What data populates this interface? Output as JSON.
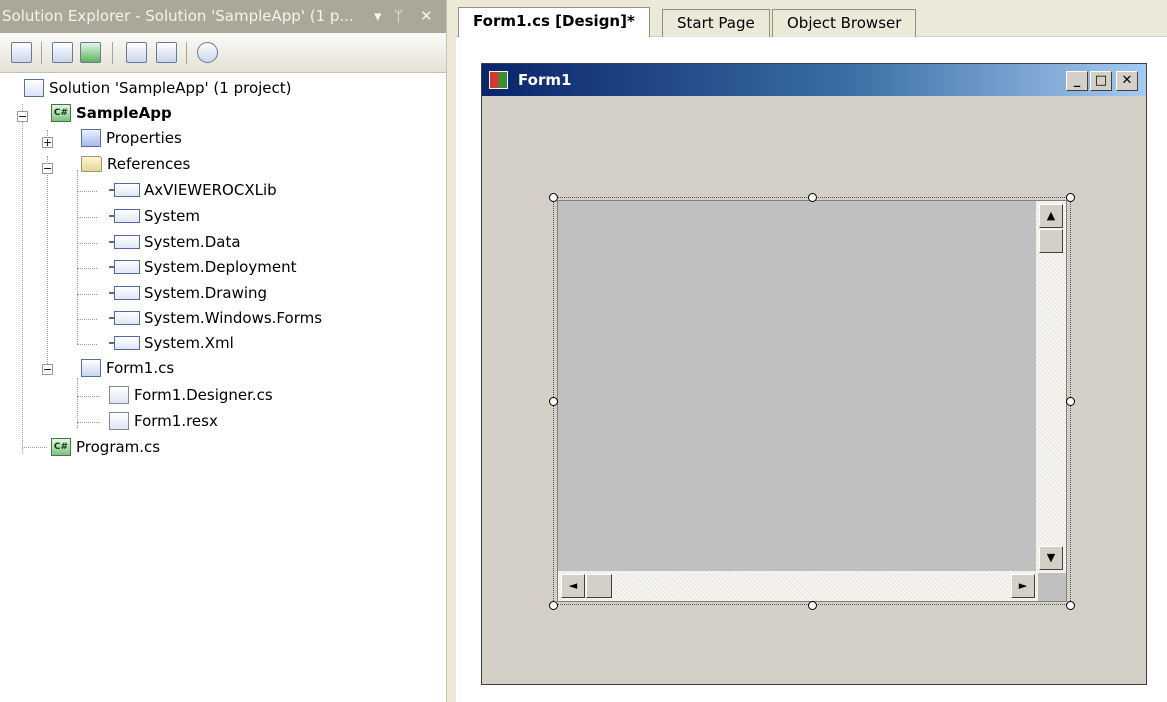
{
  "solution_explorer": {
    "title": "Solution Explorer - Solution 'SampleApp' (1 p...",
    "title_buttons": {
      "dropdown": "▾",
      "pin": "ᛘ",
      "close": "✕"
    },
    "toolbar_icons": [
      "properties-icon",
      "show-all-files-icon",
      "refresh-icon",
      "view-code-icon",
      "view-designer-icon",
      "class-diagram-icon"
    ],
    "tree": {
      "solution_label": "Solution 'SampleApp' (1 project)",
      "project_label": "SampleApp",
      "properties_label": "Properties",
      "references_label": "References",
      "references": [
        "AxVIEWEROCXLib",
        "System",
        "System.Data",
        "System.Deployment",
        "System.Drawing",
        "System.Windows.Forms",
        "System.Xml"
      ],
      "form_label": "Form1.cs",
      "form_children": [
        "Form1.Designer.cs",
        "Form1.resx"
      ],
      "program_label": "Program.cs"
    }
  },
  "tabs": [
    {
      "label": "Form1.cs [Design]*",
      "active": true
    },
    {
      "label": "Start Page",
      "active": false
    },
    {
      "label": "Object Browser",
      "active": false
    }
  ],
  "designer": {
    "form_title": "Form1",
    "caption_buttons": {
      "minimize": "_",
      "maximize": "□",
      "close": "✕"
    },
    "scroll_glyphs": {
      "up": "▲",
      "down": "▼",
      "left": "◄",
      "right": "►"
    }
  },
  "colors": {
    "title_active_start": "#0a246a",
    "title_active_end": "#a6caf0",
    "form_background": "#d4d0c8",
    "control_background": "#c0c0c0",
    "panel_header": "#a9a899"
  }
}
